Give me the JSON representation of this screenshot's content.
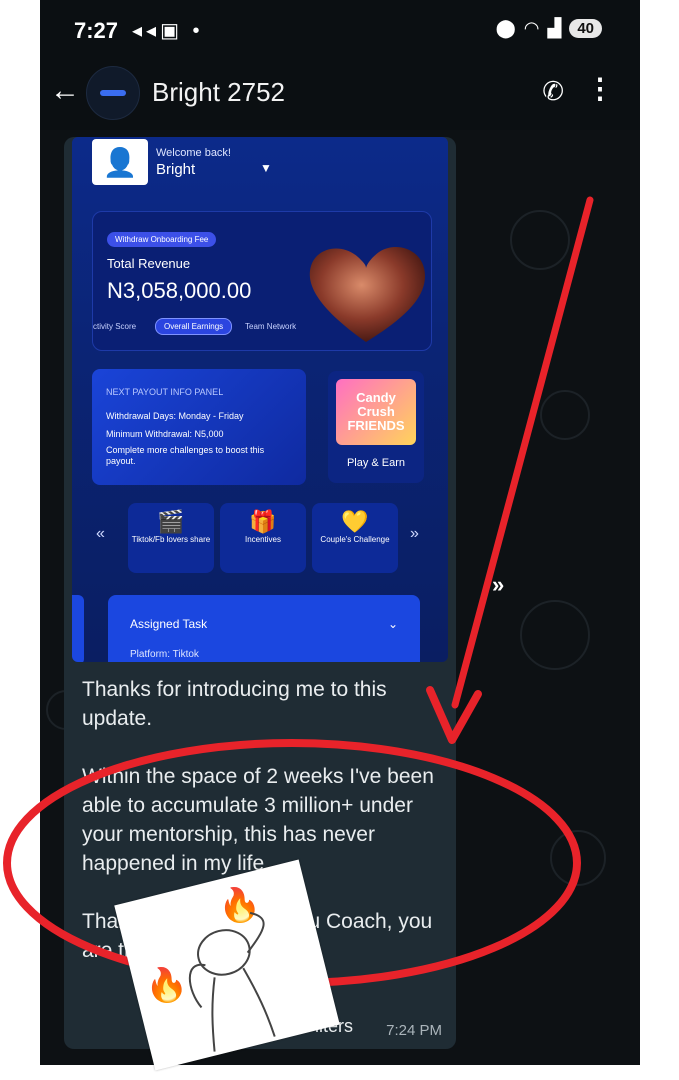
{
  "status_bar": {
    "time": "7:27",
    "left_icons": "◂◂▣ •",
    "battery": "40"
  },
  "header": {
    "contact_name": "Bright 2752"
  },
  "shared_screenshot": {
    "welcome": "Welcome back!",
    "user": "Bright",
    "fee_pill": "Withdraw Onboarding Fee",
    "revenue_label": "Total Revenue",
    "revenue_value": "N3,058,000.00",
    "tabs": [
      "ctivity Score",
      "Overall Earnings",
      "Team Network"
    ],
    "payout_title": "NEXT PAYOUT INFO PANEL",
    "payout_lines": [
      "Withdrawal Days: Monday - Friday",
      "Minimum Withdrawal: N5,000",
      "Complete more challenges to boost this payout."
    ],
    "game_art": "Candy Crush FRIENDS",
    "game_label": "Play & Earn",
    "nav_items": [
      "Tiktok/Fb lovers share",
      "Incentives",
      "Couple's Challenge"
    ],
    "task_label": "Assigned Task",
    "task_sub": "Platform: Tiktok"
  },
  "message": {
    "paragraph_1": "Thanks for introducing me to this update.",
    "paragraph_2": "Within the space of 2 weeks I've been able to accumulate 3 million+ under your mentorship, this has never happened in my life.",
    "paragraph_3": "Thank you God bless you Coach, you are the best.",
    "filters_label": "Filters",
    "time": "7:24 PM"
  },
  "annotation": {
    "color": "#e8232a"
  },
  "colors": {
    "chat_bg": "#0d1114",
    "bubble": "#1f2c34",
    "accent": "#1b47e0"
  }
}
